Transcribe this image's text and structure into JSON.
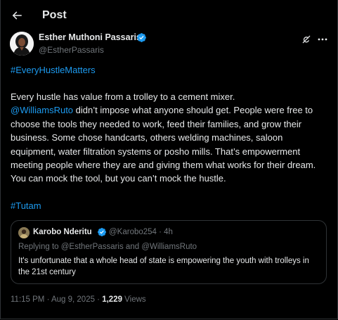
{
  "header": {
    "title": "Post",
    "back_icon": "arrow-left-icon"
  },
  "author": {
    "name": "Esther Muthoni Passaris",
    "handle": "@EstherPassaris",
    "verified_icon": "verified-badge-icon"
  },
  "actions": {
    "grok_icon": "grok-icon",
    "more_icon": "more-horizontal-icon"
  },
  "tweet": {
    "hashtag_top": "#EveryHustleMatters",
    "line1": "Every hustle has value from a trolley to a cement mixer.",
    "mention": "@WilliamsRuto",
    "rest": " didn’t impose what anyone should get. People were free to choose the tools they needed to work, feed their families, and grow their business. Some chose handcarts, others welding machines, saloon equipment, water filtration systems or posho mills. That’s empowerment meeting people where they are and giving them what works for their dream. You can mock the tool, but you can’t mock the hustle.",
    "hashtag_bottom": "#Tutam"
  },
  "quote": {
    "name": "Karobo Nderitu",
    "meta": "@Karobo254 · 4h",
    "reply_to": "Replying to @EstherPassaris and @WilliamsRuto",
    "text": "It's unfortunate that a whole head of state is empowering the youth with trolleys in the 21st century"
  },
  "footer": {
    "timestamp": "11:15 PM · Aug 9, 2025 · ",
    "views_count": "1,229",
    "views_label": " Views"
  },
  "colors": {
    "background": "#000000",
    "text": "#e7e9ea",
    "secondary": "#71767b",
    "accent": "#1d9bf0",
    "border": "#2f3336"
  }
}
